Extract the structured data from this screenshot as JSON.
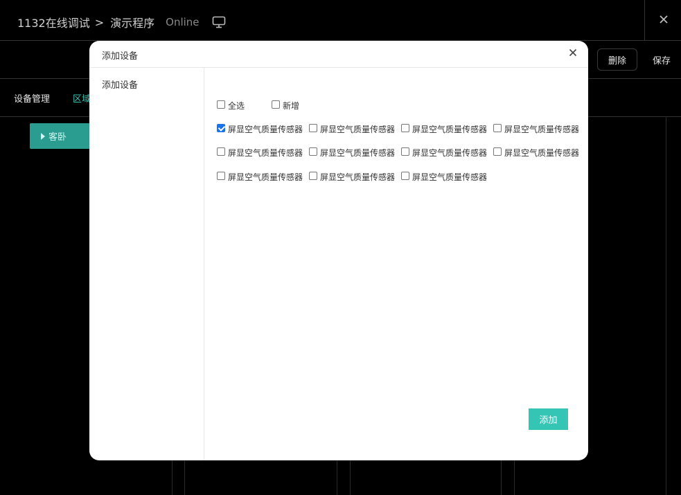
{
  "header": {
    "project": "1132在线调试",
    "separator": ">",
    "program": "演示程序",
    "status": "Online"
  },
  "toolbar": {
    "delete_label": "删除",
    "save_label": "保存"
  },
  "tabs": [
    "设备管理",
    "区域"
  ],
  "room": {
    "label": "客卧"
  },
  "modal": {
    "title": "添加设备",
    "sidebar_items": [
      "添加设备"
    ],
    "select_all_label": "全选",
    "new_label": "新增",
    "devices": [
      {
        "label": "屏显空气质量传感器",
        "checked": true
      },
      {
        "label": "屏显空气质量传感器",
        "checked": false
      },
      {
        "label": "屏显空气质量传感器",
        "checked": false
      },
      {
        "label": "屏显空气质量传感器",
        "checked": false
      },
      {
        "label": "屏显空气质量传感器",
        "checked": false
      },
      {
        "label": "屏显空气质量传感器",
        "checked": false
      },
      {
        "label": "屏显空气质量传感器",
        "checked": false
      },
      {
        "label": "屏显空气质量传感器",
        "checked": false
      },
      {
        "label": "屏显空气质量传感器",
        "checked": false
      },
      {
        "label": "屏显空气质量传感器",
        "checked": false
      },
      {
        "label": "屏显空气质量传感器",
        "checked": false
      }
    ],
    "add_button_label": "添加"
  },
  "colors": {
    "accent": "#35c5b5",
    "room_chip": "#2a9d90",
    "checkbox_checked": "#1a73e8"
  },
  "icons": [
    "monitor-icon",
    "close-icon",
    "triangle-right-icon"
  ]
}
